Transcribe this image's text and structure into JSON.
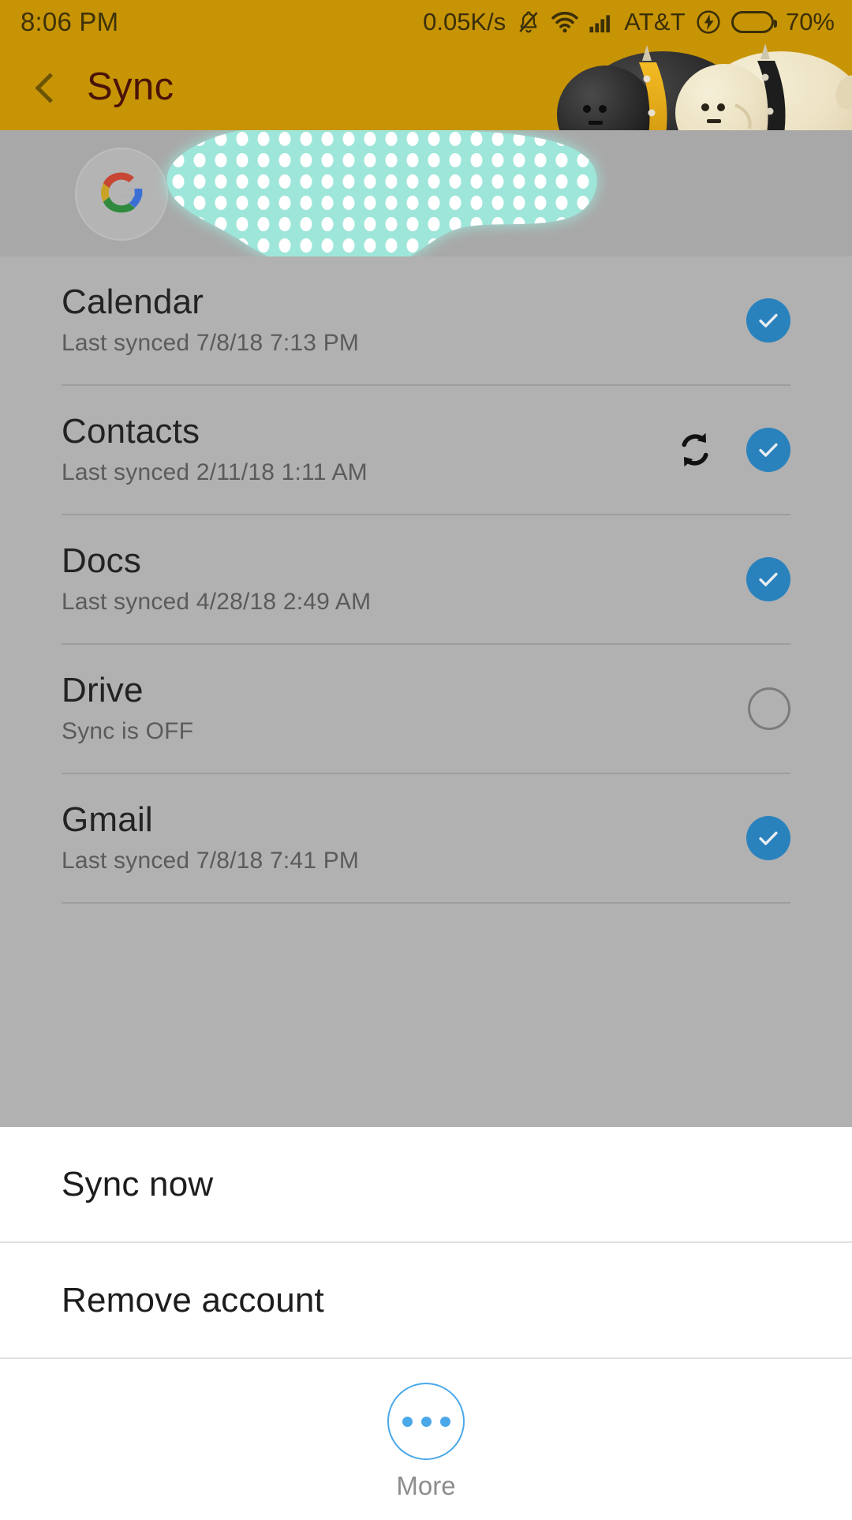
{
  "status_bar": {
    "time": "8:06 PM",
    "net_speed": "0.05K/s",
    "mute_icon": "bell-muted-icon",
    "wifi_icon": "wifi-icon",
    "signal_icon": "cellular-signal-icon",
    "carrier": "AT&T",
    "charging_icon": "charging-bolt-icon",
    "battery_icon": "battery-icon",
    "battery_percent": "70%",
    "battery_level": 70,
    "background_color": "#c79405"
  },
  "header": {
    "back_icon": "back-chevron-icon",
    "title": "Sync",
    "title_color": "#4a1307",
    "background_color": "#c79405",
    "decoration": "cartoon-characters-illustration"
  },
  "account": {
    "avatar_icon": "google-logo-icon",
    "email_redacted": true,
    "redaction_color": "#9fe6da"
  },
  "sync_list": {
    "background_color": "#b1b1b1",
    "items": [
      {
        "title": "Calendar",
        "subtitle": "Last synced 7/8/18 7:13 PM",
        "checked": true,
        "syncing": false
      },
      {
        "title": "Contacts",
        "subtitle": "Last synced 2/11/18 1:11 AM",
        "checked": true,
        "syncing": true
      },
      {
        "title": "Docs",
        "subtitle": "Last synced 4/28/18 2:49 AM",
        "checked": true,
        "syncing": false
      },
      {
        "title": "Drive",
        "subtitle": "Sync is OFF",
        "checked": false,
        "syncing": false
      },
      {
        "title": "Gmail",
        "subtitle": "Last synced 7/8/18 7:41 PM",
        "checked": true,
        "syncing": false
      }
    ],
    "checked_color": "#2a82bd"
  },
  "bottom_sheet": {
    "sync_now_label": "Sync now",
    "remove_account_label": "Remove account",
    "more_icon": "more-dots-icon",
    "more_label": "More",
    "accent_color": "#4aa8e8"
  }
}
